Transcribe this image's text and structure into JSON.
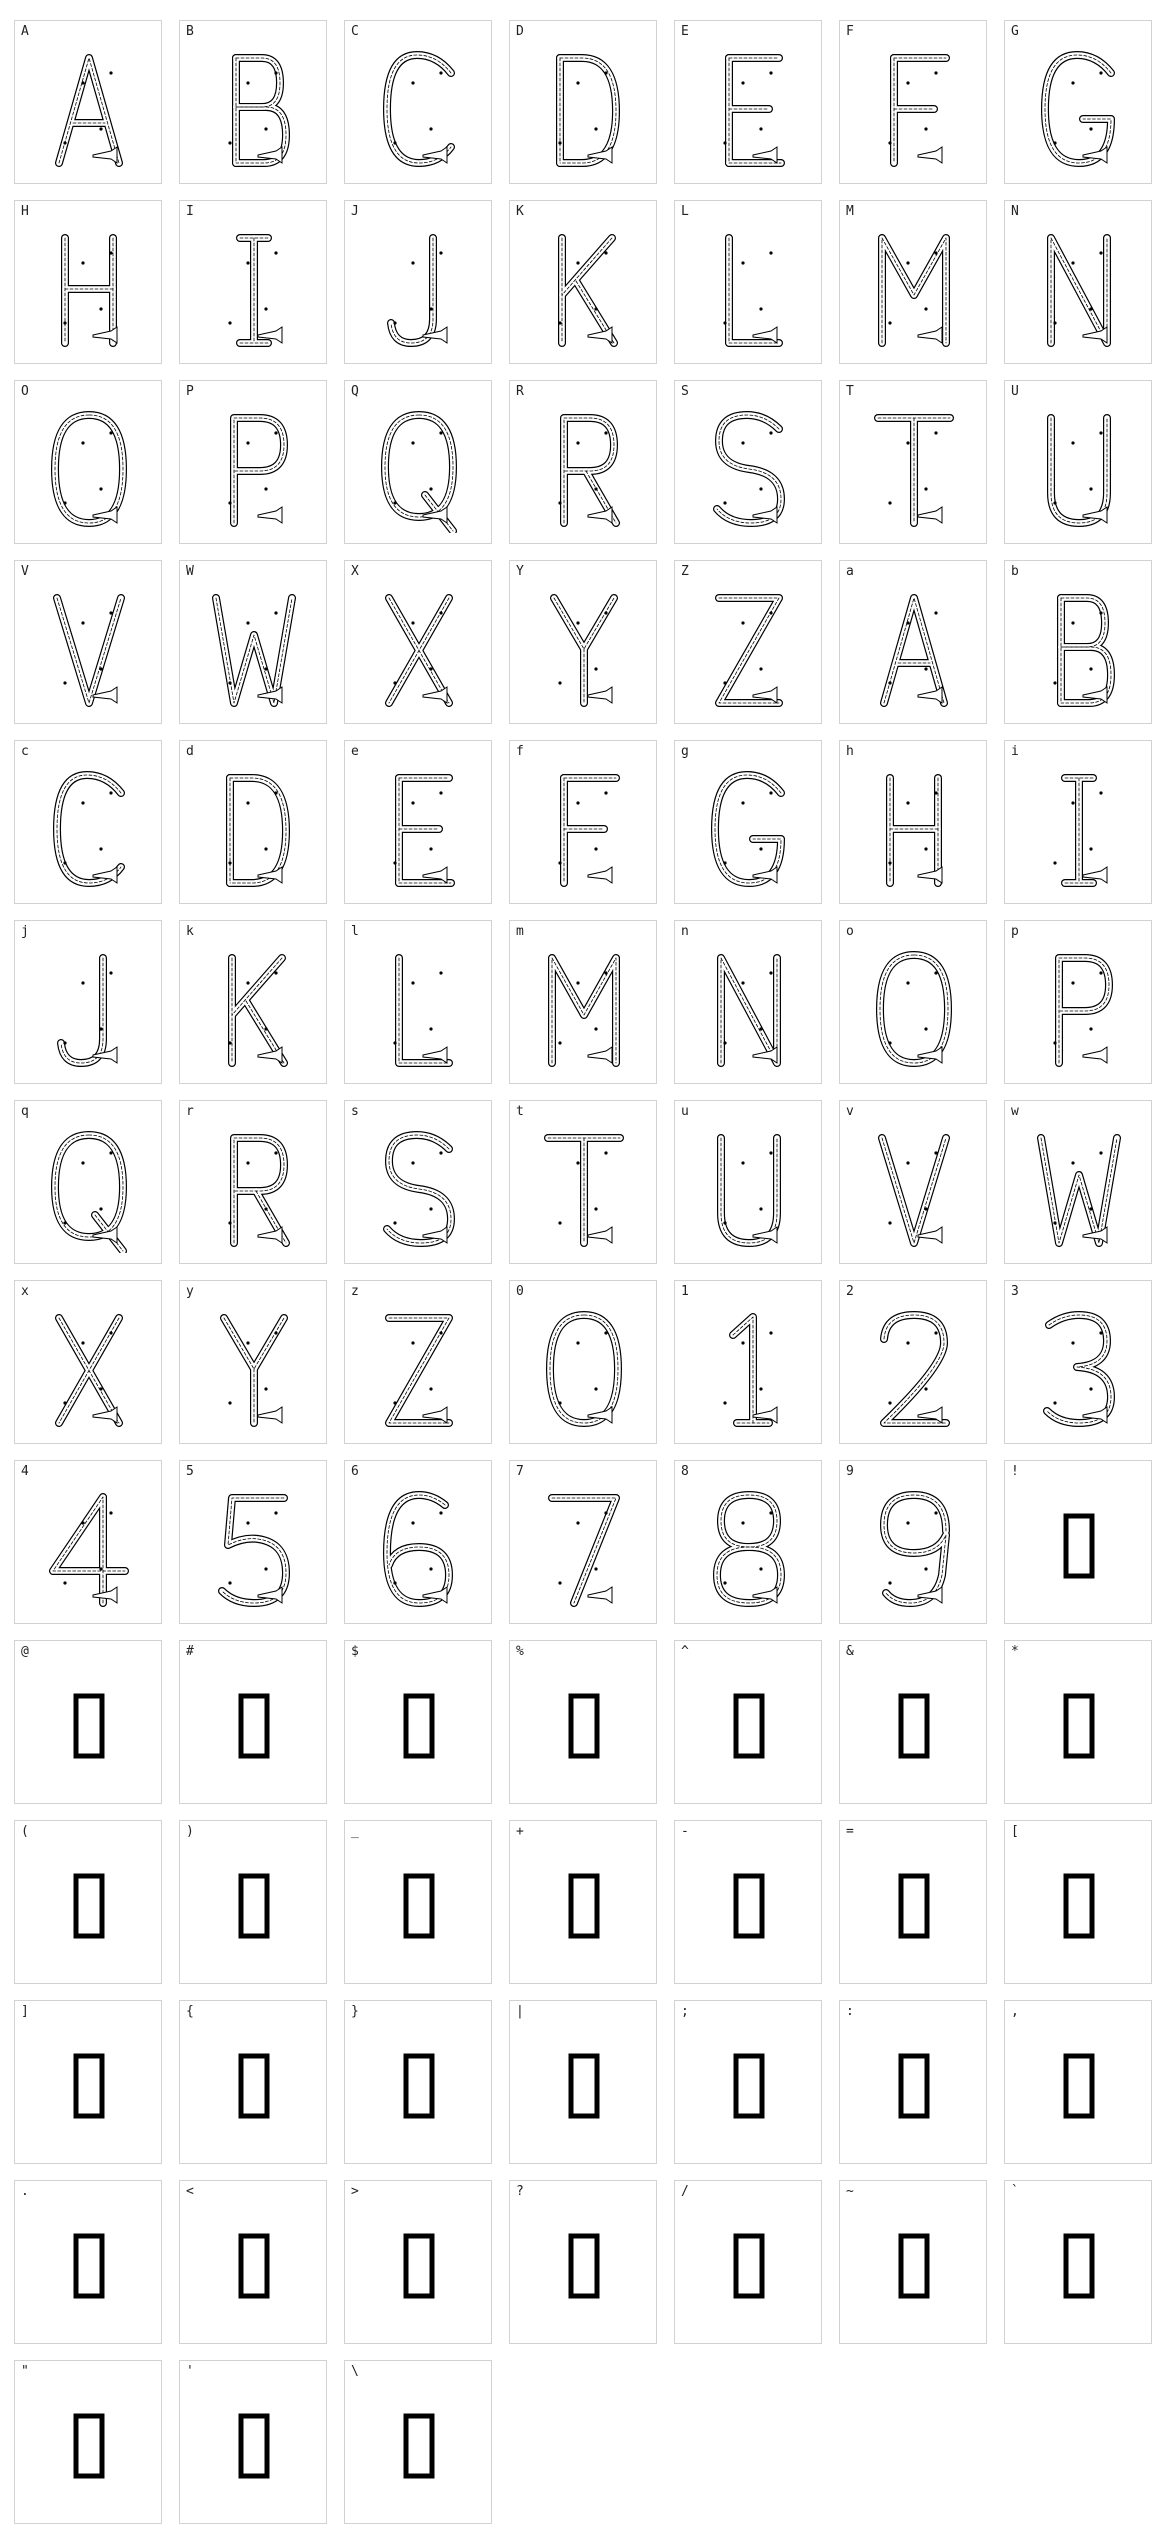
{
  "chart_data": {
    "type": "table",
    "title": "",
    "columns": 7
  },
  "glyph_cells": [
    {
      "char": "A",
      "kind": "letter",
      "style": "A"
    },
    {
      "char": "B",
      "kind": "letter",
      "style": "B"
    },
    {
      "char": "C",
      "kind": "letter",
      "style": "C"
    },
    {
      "char": "D",
      "kind": "letter",
      "style": "D"
    },
    {
      "char": "E",
      "kind": "letter",
      "style": "E"
    },
    {
      "char": "F",
      "kind": "letter",
      "style": "F"
    },
    {
      "char": "G",
      "kind": "letter",
      "style": "G"
    },
    {
      "char": "H",
      "kind": "letter",
      "style": "H"
    },
    {
      "char": "I",
      "kind": "letter",
      "style": "I"
    },
    {
      "char": "J",
      "kind": "letter",
      "style": "J"
    },
    {
      "char": "K",
      "kind": "letter",
      "style": "K"
    },
    {
      "char": "L",
      "kind": "letter",
      "style": "L"
    },
    {
      "char": "M",
      "kind": "letter",
      "style": "M"
    },
    {
      "char": "N",
      "kind": "letter",
      "style": "N"
    },
    {
      "char": "O",
      "kind": "letter",
      "style": "O"
    },
    {
      "char": "P",
      "kind": "letter",
      "style": "P"
    },
    {
      "char": "Q",
      "kind": "letter",
      "style": "Q"
    },
    {
      "char": "R",
      "kind": "letter",
      "style": "R"
    },
    {
      "char": "S",
      "kind": "letter",
      "style": "S"
    },
    {
      "char": "T",
      "kind": "letter",
      "style": "T"
    },
    {
      "char": "U",
      "kind": "letter",
      "style": "U"
    },
    {
      "char": "V",
      "kind": "letter",
      "style": "V"
    },
    {
      "char": "W",
      "kind": "letter",
      "style": "W"
    },
    {
      "char": "X",
      "kind": "letter",
      "style": "X"
    },
    {
      "char": "Y",
      "kind": "letter",
      "style": "Y"
    },
    {
      "char": "Z",
      "kind": "letter",
      "style": "Z"
    },
    {
      "char": "a",
      "kind": "letter",
      "style": "A"
    },
    {
      "char": "b",
      "kind": "letter",
      "style": "B"
    },
    {
      "char": "c",
      "kind": "letter",
      "style": "C"
    },
    {
      "char": "d",
      "kind": "letter",
      "style": "D"
    },
    {
      "char": "e",
      "kind": "letter",
      "style": "E"
    },
    {
      "char": "f",
      "kind": "letter",
      "style": "F"
    },
    {
      "char": "g",
      "kind": "letter",
      "style": "G"
    },
    {
      "char": "h",
      "kind": "letter",
      "style": "H"
    },
    {
      "char": "i",
      "kind": "letter",
      "style": "I"
    },
    {
      "char": "j",
      "kind": "letter",
      "style": "J"
    },
    {
      "char": "k",
      "kind": "letter",
      "style": "K"
    },
    {
      "char": "l",
      "kind": "letter",
      "style": "L"
    },
    {
      "char": "m",
      "kind": "letter",
      "style": "M"
    },
    {
      "char": "n",
      "kind": "letter",
      "style": "N"
    },
    {
      "char": "o",
      "kind": "letter",
      "style": "O"
    },
    {
      "char": "p",
      "kind": "letter",
      "style": "P"
    },
    {
      "char": "q",
      "kind": "letter",
      "style": "Q"
    },
    {
      "char": "r",
      "kind": "letter",
      "style": "R"
    },
    {
      "char": "s",
      "kind": "letter",
      "style": "S"
    },
    {
      "char": "t",
      "kind": "letter",
      "style": "T"
    },
    {
      "char": "u",
      "kind": "letter",
      "style": "U"
    },
    {
      "char": "v",
      "kind": "letter",
      "style": "V"
    },
    {
      "char": "w",
      "kind": "letter",
      "style": "W"
    },
    {
      "char": "x",
      "kind": "letter",
      "style": "X"
    },
    {
      "char": "y",
      "kind": "letter",
      "style": "Y"
    },
    {
      "char": "z",
      "kind": "letter",
      "style": "Z"
    },
    {
      "char": "0",
      "kind": "digit",
      "style": "0"
    },
    {
      "char": "1",
      "kind": "digit",
      "style": "1"
    },
    {
      "char": "2",
      "kind": "digit",
      "style": "2"
    },
    {
      "char": "3",
      "kind": "digit",
      "style": "3"
    },
    {
      "char": "4",
      "kind": "digit",
      "style": "4"
    },
    {
      "char": "5",
      "kind": "digit",
      "style": "5"
    },
    {
      "char": "6",
      "kind": "digit",
      "style": "6"
    },
    {
      "char": "7",
      "kind": "digit",
      "style": "7"
    },
    {
      "char": "8",
      "kind": "digit",
      "style": "8"
    },
    {
      "char": "9",
      "kind": "digit",
      "style": "9"
    },
    {
      "char": "!",
      "kind": "missing"
    },
    {
      "char": "@",
      "kind": "missing"
    },
    {
      "char": "#",
      "kind": "missing"
    },
    {
      "char": "$",
      "kind": "missing"
    },
    {
      "char": "%",
      "kind": "missing"
    },
    {
      "char": "^",
      "kind": "missing"
    },
    {
      "char": "&",
      "kind": "missing"
    },
    {
      "char": "*",
      "kind": "missing"
    },
    {
      "char": "(",
      "kind": "missing"
    },
    {
      "char": ")",
      "kind": "missing"
    },
    {
      "char": "_",
      "kind": "missing"
    },
    {
      "char": "+",
      "kind": "missing"
    },
    {
      "char": "-",
      "kind": "missing"
    },
    {
      "char": "=",
      "kind": "missing"
    },
    {
      "char": "[",
      "kind": "missing"
    },
    {
      "char": "]",
      "kind": "missing"
    },
    {
      "char": "{",
      "kind": "missing"
    },
    {
      "char": "}",
      "kind": "missing"
    },
    {
      "char": "|",
      "kind": "missing"
    },
    {
      "char": ";",
      "kind": "missing"
    },
    {
      "char": ":",
      "kind": "missing"
    },
    {
      "char": ",",
      "kind": "missing"
    },
    {
      "char": ".",
      "kind": "missing"
    },
    {
      "char": "<",
      "kind": "missing"
    },
    {
      "char": ">",
      "kind": "missing"
    },
    {
      "char": "?",
      "kind": "missing"
    },
    {
      "char": "/",
      "kind": "missing"
    },
    {
      "char": "~",
      "kind": "missing"
    },
    {
      "char": "`",
      "kind": "missing"
    },
    {
      "char": "\"",
      "kind": "missing"
    },
    {
      "char": "'",
      "kind": "missing"
    },
    {
      "char": "\\",
      "kind": "missing"
    }
  ],
  "colors": {
    "cell_border": "#d2d2d2",
    "ink": "#000000",
    "label": "#222222",
    "background": "#ffffff"
  }
}
